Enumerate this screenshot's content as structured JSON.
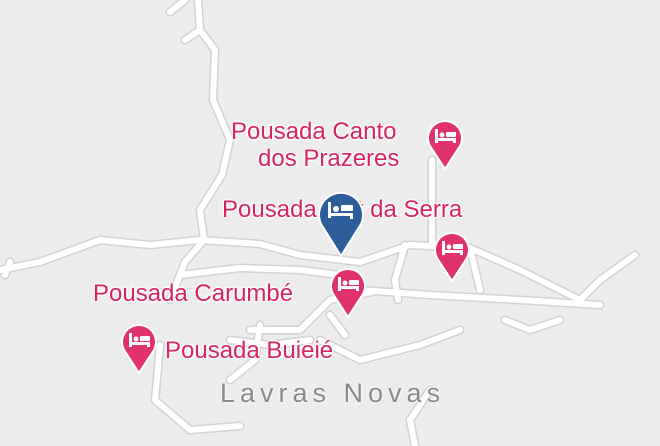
{
  "map": {
    "town_name": "Lavras Novas",
    "colors": {
      "background": "#ececec",
      "road": "#ffffff",
      "road_edge": "#d4d4d4",
      "hotel_label": "#d6245f",
      "hotel_pin": "#e0336e",
      "selected_pin": "#2d5e9a"
    },
    "places": [
      {
        "name_line1": "Pousada Canto",
        "name_line2": "dos Prazeres",
        "icon": "bed-icon"
      },
      {
        "name": "Pousada Loft da Serra",
        "icon": "bed-icon",
        "selected": true
      },
      {
        "name": "Pousada Carumbé",
        "icon": "bed-icon"
      },
      {
        "name": "Pousada Buieié",
        "icon": "bed-icon"
      },
      {
        "name": "",
        "icon": "bed-icon"
      }
    ]
  }
}
